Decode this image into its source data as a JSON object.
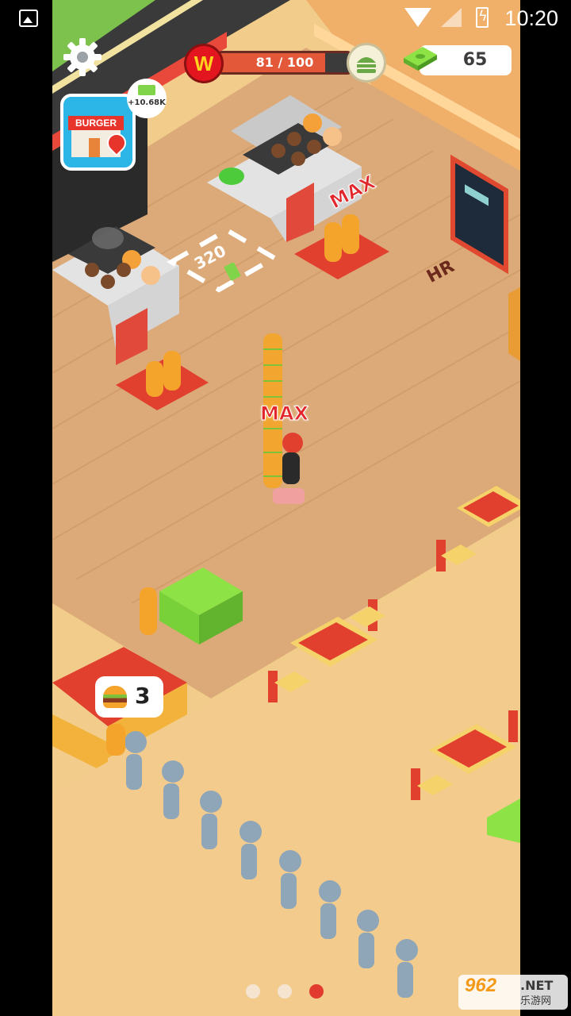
{
  "status_bar": {
    "time": "10:20",
    "icons": [
      "image-icon",
      "wifi-icon",
      "signal-icon",
      "battery-charging-icon"
    ]
  },
  "hud": {
    "settings_icon": "gear-icon",
    "progress_badge_letter": "W",
    "progress_text": "81 / 100",
    "progress_fraction": 0.81,
    "goal_icon": "burger-icon",
    "money_icon": "cash-stack-icon",
    "money": "65",
    "colors": {
      "brand_red": "#e3161f",
      "progress_fill": "#e4583a",
      "cash_green": "#7fd44a"
    }
  },
  "shop": {
    "label": "BURGER",
    "income_bubble": "+10.68K"
  },
  "world": {
    "grill_max_label": "MAX",
    "player_max_label": "MAX",
    "upgrade_pad_value": "320",
    "upgrade_pad_tag": "MAX",
    "hr_label": "HR",
    "counter_burgers": "3"
  },
  "pagination": {
    "total": 3,
    "active": 3
  },
  "watermark": {
    "brand": "962",
    "domain": ".NET",
    "sub": "乐游网"
  }
}
